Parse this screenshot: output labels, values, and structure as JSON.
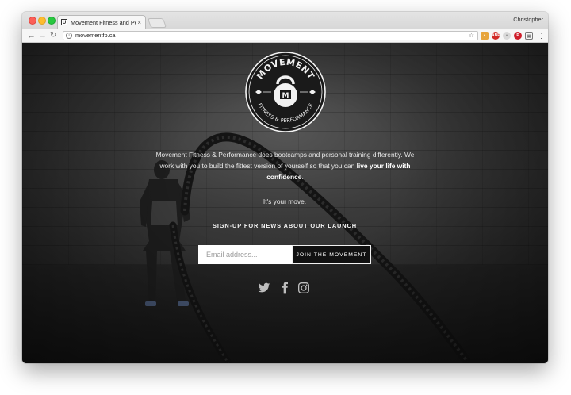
{
  "browser": {
    "tab_favicon": "U",
    "tab_title": "Movement Fitness and Performance",
    "tab_close": "×",
    "profile_name": "Christopher",
    "url": "movementfp.ca",
    "icons": [
      "back-arrow-icon",
      "forward-arrow-icon",
      "reload-icon",
      "info-icon",
      "star-icon",
      "extension-icons",
      "menu-icon"
    ]
  },
  "logo": {
    "top_text": "MOVEMENT",
    "bottom_text": "FITNESS & PERFORMANCE",
    "monogram": "M"
  },
  "hero": {
    "intro_text": "Movement Fitness & Performance does bootcamps and personal training differently. We work with you to build the fittest version of yourself so that you can",
    "intro_bold": "live your life with confidence",
    "intro_end": ".",
    "tagline": "It's your move.",
    "signup_heading": "SIGN-UP FOR NEWS ABOUT OUR LAUNCH",
    "email_placeholder": "Email address...",
    "email_value": "",
    "join_label": "JOIN THE MOVEMENT"
  },
  "social": [
    "twitter-icon",
    "facebook-icon",
    "instagram-icon"
  ]
}
